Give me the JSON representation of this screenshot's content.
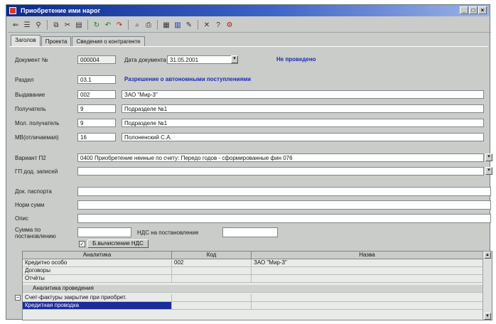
{
  "window": {
    "title": "Приобретение ими нарог",
    "buttons": [
      "_",
      "□",
      "×"
    ]
  },
  "toolbar": {
    "icons": [
      "save-icon",
      "list-icon",
      "filter-icon",
      "copy-icon",
      "cut-icon",
      "paste-icon",
      "refresh-icon",
      "undo-icon",
      "redo-icon",
      "find-icon",
      "print-icon",
      "calc-icon",
      "table-icon",
      "edit-icon",
      "delete-icon",
      "help-icon",
      "tools-icon"
    ]
  },
  "tabs": [
    "Заголов",
    "Проекта",
    "Сведения о контрагенте"
  ],
  "form": {
    "doc_no_label": "Документ №",
    "doc_no_value": "000004",
    "doc_date_label": "Дата документа",
    "doc_date_value": "31.05.2001",
    "status": "Не проведено",
    "section_label": "Раздел",
    "section_value": "03.1",
    "section_desc": "Разрешение о автономными поступлениями",
    "supplier_label": "Выдавание",
    "supplier_code": "002",
    "supplier_name": "ЗАО \"Мир-3\"",
    "recipient_label": "Получатель",
    "recipient_code": "9",
    "recipient_name": "Подразделе №1",
    "place_label": "Мол. получатель",
    "place_code": "9",
    "place_name": "Подразделе №1",
    "mol_label": "МВ(отличаемая)",
    "mol_code": "16",
    "mol_name": "Полоненский С.А.",
    "op_label": "Вариант П2",
    "op_value": "0400 Приобретение неиные по счету: Передо годов - сформированные фин 076",
    "gp_label": "ГП дод. записей",
    "gp_value": "",
    "basis_label": "Док. паспорта",
    "basis_value": "",
    "reason_label": "Норм сумм",
    "reason_value": "",
    "note_label": "Опис",
    "note_value": "",
    "sum_label": "Сумма по постановлению",
    "sum_value": "",
    "vat_label": "НДС на постановление",
    "vat_value": "",
    "vat_check": "✓",
    "vat_button": "Б.вычисление НДС"
  },
  "grid": {
    "headers": [
      "Аналитика",
      "Код",
      "Назва"
    ],
    "rows": [
      {
        "c0": "Кредитно особо",
        "c1": "002",
        "c2": "ЗАО \"Мир-3\"",
        "group": false
      },
      {
        "c0": "Договоры",
        "c1": "",
        "c2": "",
        "group": false
      },
      {
        "c0": "Отчёты",
        "c1": "",
        "c2": "",
        "group": false
      },
      {
        "c0": "Аналитика проведения",
        "c1": "",
        "c2": "",
        "group": true
      },
      {
        "c0": "Счет-фактуры закрытие при приобрет.",
        "c1": "",
        "c2": "",
        "group": false
      },
      {
        "c0": "Кредитная проводка",
        "c1": "",
        "c2": "",
        "group": false,
        "selected": true
      }
    ]
  },
  "colors": {
    "titlebar_start": "#0b2a8f",
    "window_bg": "#c9ccc8",
    "status_text": "#1a2bb8",
    "selection": "#1a2b9a"
  }
}
